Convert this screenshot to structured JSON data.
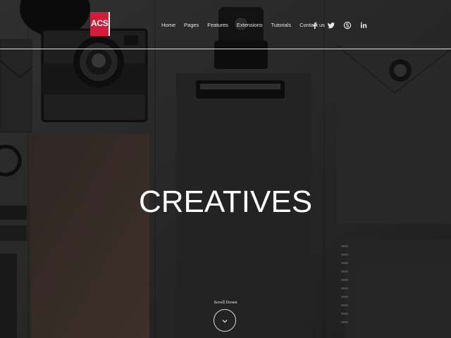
{
  "brand": {
    "logo_text": "ACS",
    "accent": "#d41b3c"
  },
  "nav": {
    "items": [
      "Home",
      "Pages",
      "Features",
      "Extensions",
      "Tutorials",
      "Contact us"
    ]
  },
  "social": {
    "icons": [
      "facebook-icon",
      "twitter-icon",
      "skype-icon",
      "linkedin-icon"
    ]
  },
  "hero": {
    "title": "CREATIVES",
    "scroll_label": "Scroll Down"
  }
}
